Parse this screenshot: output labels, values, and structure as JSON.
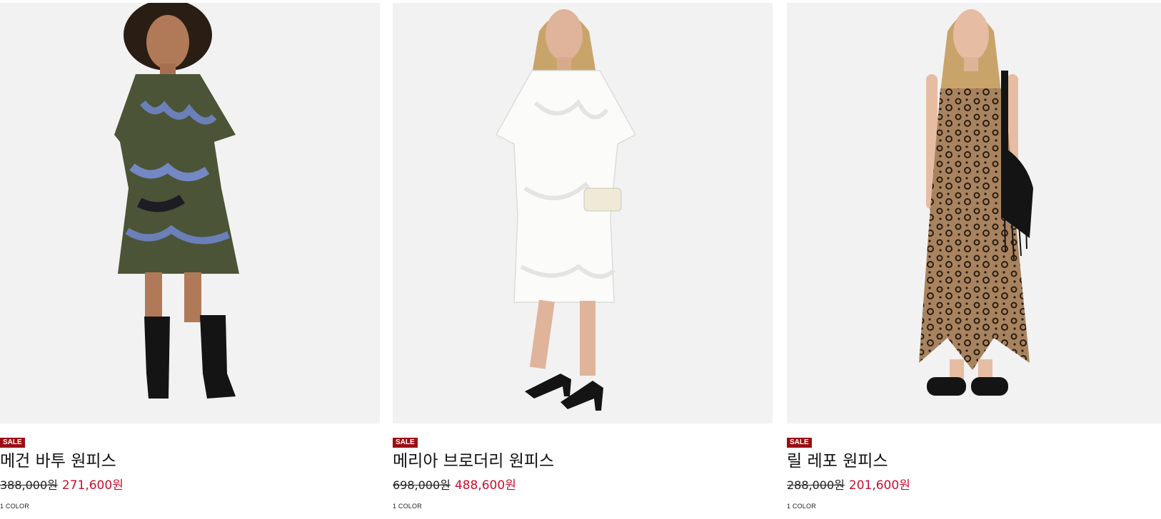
{
  "products": [
    {
      "badge": "SALE",
      "name": "메건 바투 원피스",
      "original_price": "388,000원",
      "sale_price": "271,600원",
      "colors": "1 COLOR",
      "dress_color": "#4b5436"
    },
    {
      "badge": "SALE",
      "name": "메리아 브로더리 원피스",
      "original_price": "698,000원",
      "sale_price": "488,600원",
      "colors": "1 COLOR",
      "dress_color": "#f8f8f6"
    },
    {
      "badge": "SALE",
      "name": "릴 레포 원피스",
      "original_price": "288,000원",
      "sale_price": "201,600원",
      "colors": "1 COLOR",
      "dress_color": "#9a7656"
    }
  ],
  "colors": {
    "badge_bg": "#9b0f14",
    "sale_price": "#c8102e",
    "photo_bg": "#f1f1f1"
  }
}
